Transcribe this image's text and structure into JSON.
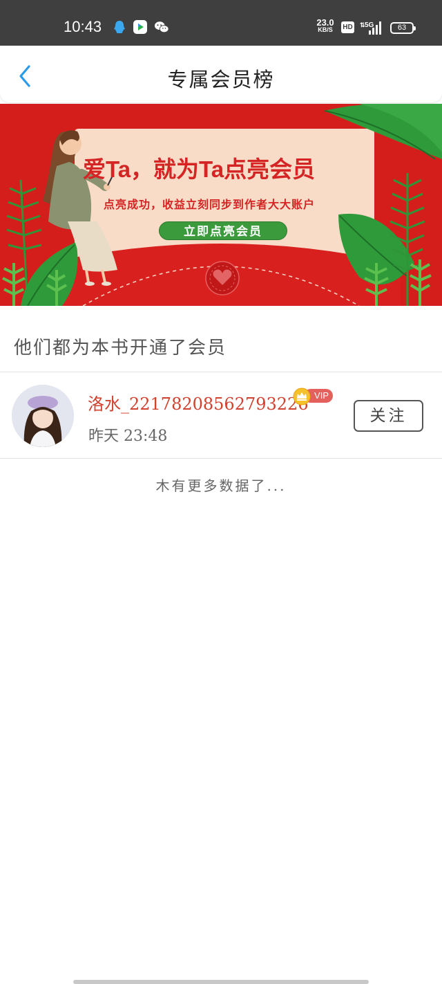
{
  "status_bar": {
    "time": "10:43",
    "net_speed_value": "23.0",
    "net_speed_unit": "KB/S",
    "hd_label": "HD",
    "network_label": "5G",
    "battery": "63",
    "icons": [
      "qq-icon",
      "video-app-icon",
      "wechat-icon"
    ]
  },
  "header": {
    "title": "专属会员榜",
    "back_icon": "chevron-left-icon"
  },
  "banner": {
    "headline": "爱Ta，就为Ta点亮会员",
    "subline": "点亮成功，收益立刻同步到作者大大账户",
    "cta": "立即点亮会员"
  },
  "section": {
    "title": "他们都为本书开通了会员"
  },
  "members": [
    {
      "name": "洛水_22178208562793226",
      "badge": "VIP",
      "time": "昨天 23:48",
      "follow_label": "关注"
    }
  ],
  "list_footer": "木有更多数据了...",
  "colors": {
    "accent_blue": "#2a9be8",
    "member_name": "#d0422e",
    "banner_red": "#d31e1c",
    "cta_green": "#3b9a3c",
    "vip_pill": "#e4605c"
  }
}
